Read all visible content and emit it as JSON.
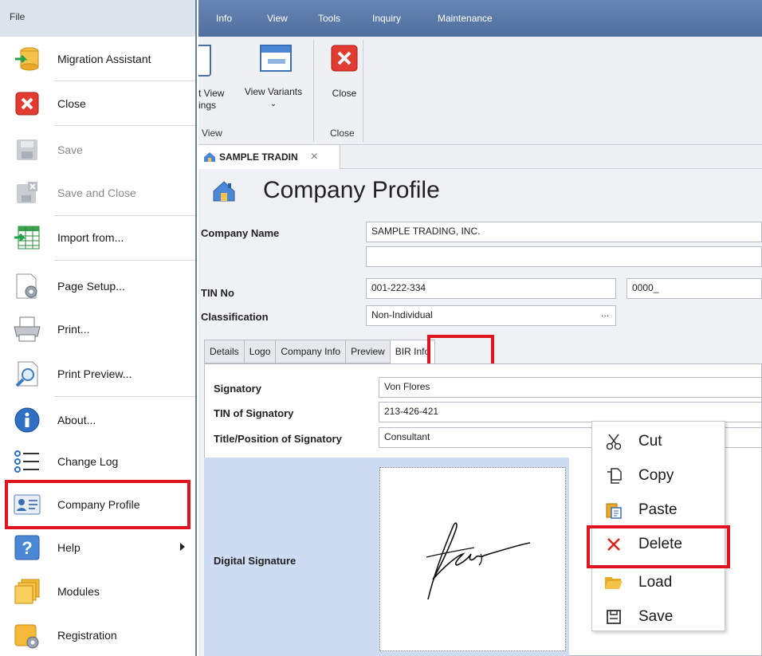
{
  "file_menu": {
    "header": "File",
    "items": [
      {
        "label": "Migration Assistant",
        "icon": "database-arrow-icon"
      },
      {
        "label": "Close",
        "icon": "close-icon"
      },
      {
        "label": "Save",
        "icon": "save-disk-icon"
      },
      {
        "label": "Save and Close",
        "icon": "save-close-icon"
      },
      {
        "label": "Import from...",
        "icon": "import-spreadsheet-icon"
      },
      {
        "label": "Page Setup...",
        "icon": "page-setup-icon"
      },
      {
        "label": "Print...",
        "icon": "printer-icon"
      },
      {
        "label": "Print Preview...",
        "icon": "print-preview-icon"
      },
      {
        "label": "About...",
        "icon": "info-icon"
      },
      {
        "label": "Change Log",
        "icon": "list-icon"
      },
      {
        "label": "Company Profile",
        "icon": "company-profile-icon"
      },
      {
        "label": "Help",
        "icon": "help-icon"
      },
      {
        "label": "Modules",
        "icon": "modules-icon"
      },
      {
        "label": "Registration",
        "icon": "registration-icon"
      }
    ]
  },
  "top_tabs": [
    "Info",
    "View",
    "Tools",
    "Inquiry",
    "Maintenance"
  ],
  "ribbon": {
    "btn_view_settings": "t View\nings",
    "btn_view_variants": "View Variants",
    "btn_close": "Close",
    "group_view": "View",
    "group_close": "Close"
  },
  "doc_tab": {
    "label": "SAMPLE TRADIN",
    "close": "×"
  },
  "form": {
    "title": "Company Profile",
    "company_name_label": "Company Name",
    "company_name": "SAMPLE TRADING, INC.",
    "company_name_2": "",
    "tin_label": "TIN No",
    "tin": "001-222-334",
    "tin_branch": "0000_",
    "classification_label": "Classification",
    "classification": "Non-Individual",
    "classification_btn": "...",
    "tabs": [
      "Details",
      "Logo",
      "Company Info",
      "Preview",
      "BIR Info"
    ],
    "signatory_label": "Signatory",
    "signatory": "Von Flores",
    "tin_signatory_label": "TIN of Signatory",
    "tin_signatory": "213-426-421",
    "title_position_label": "Title/Position of Signatory",
    "title_position": "Consultant",
    "digital_signature_label": "Digital Signature"
  },
  "context_menu": [
    {
      "label": "Cut",
      "icon": "scissors-icon"
    },
    {
      "label": "Copy",
      "icon": "copy-icon"
    },
    {
      "label": "Paste",
      "icon": "paste-icon"
    },
    {
      "label": "Delete",
      "icon": "delete-x-icon"
    },
    {
      "label": "Load",
      "icon": "folder-open-icon"
    },
    {
      "label": "Save",
      "icon": "save-icon"
    }
  ],
  "colors": {
    "highlight": "#e0141e",
    "topbar": "#5d7aa6",
    "signature_bg": "#cddcf2"
  }
}
